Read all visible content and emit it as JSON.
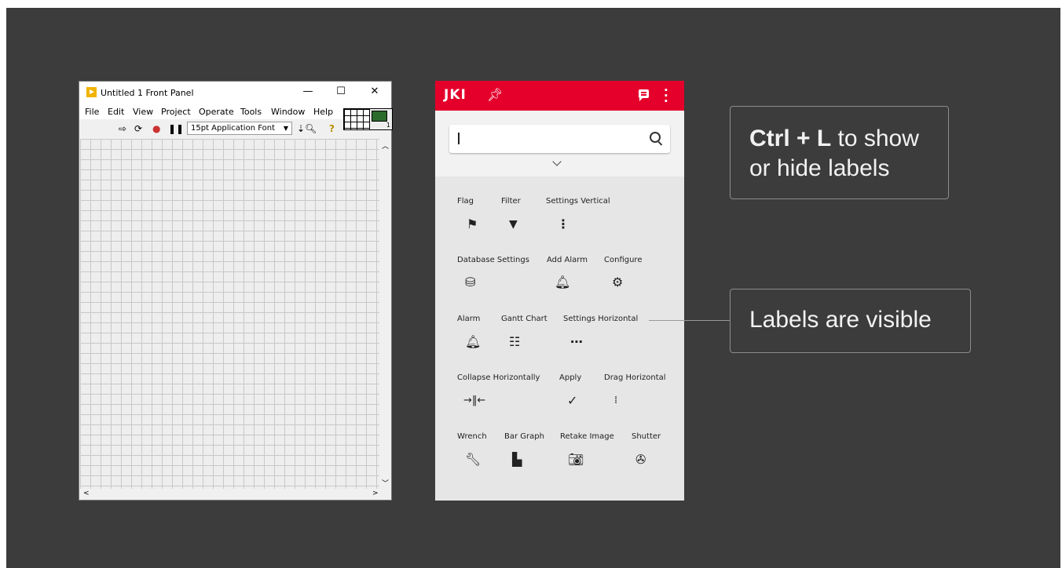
{
  "labview": {
    "title": "Untitled 1 Front Panel",
    "window_controls": [
      "—",
      "☐",
      "✕"
    ],
    "menu": [
      "File",
      "Edit",
      "View",
      "Project",
      "Operate",
      "Tools",
      "Window",
      "Help"
    ],
    "toolbar": {
      "font": "15pt Application Font",
      "icons": [
        "run-arrow-icon",
        "run-continuous-icon",
        "abort-icon",
        "pause-icon",
        "align-icon",
        "zoom-icon",
        "help-icon"
      ]
    },
    "vi_number": "1"
  },
  "jki": {
    "logo": "JKI",
    "search": {
      "value": "",
      "placeholder": ""
    },
    "items": [
      {
        "label": "Flag",
        "icon": "flag-icon"
      },
      {
        "label": "Filter",
        "icon": "filter-icon"
      },
      {
        "label": "Settings Vertical",
        "icon": "settings-vertical-icon"
      },
      {
        "label": "Database Settings",
        "icon": "database-settings-icon"
      },
      {
        "label": "Add Alarm",
        "icon": "add-alarm-icon"
      },
      {
        "label": "Configure",
        "icon": "configure-icon"
      },
      {
        "label": "Alarm",
        "icon": "alarm-icon"
      },
      {
        "label": "Gantt Chart",
        "icon": "gantt-chart-icon"
      },
      {
        "label": "Settings Horizontal",
        "icon": "settings-horizontal-icon"
      },
      {
        "label": "Collapse Horizontally",
        "icon": "collapse-horizontally-icon"
      },
      {
        "label": "Apply",
        "icon": "apply-icon"
      },
      {
        "label": "Drag Horizontal",
        "icon": "drag-horizontal-icon"
      },
      {
        "label": "Wrench",
        "icon": "wrench-icon"
      },
      {
        "label": "Bar Graph",
        "icon": "bar-graph-icon"
      },
      {
        "label": "Retake Image",
        "icon": "retake-image-icon"
      },
      {
        "label": "Shutter",
        "icon": "shutter-icon"
      }
    ]
  },
  "callouts": {
    "shortcut_bold": "Ctrl + L",
    "shortcut_rest": " to show or hide labels",
    "labels_visible": "Labels are visible"
  }
}
